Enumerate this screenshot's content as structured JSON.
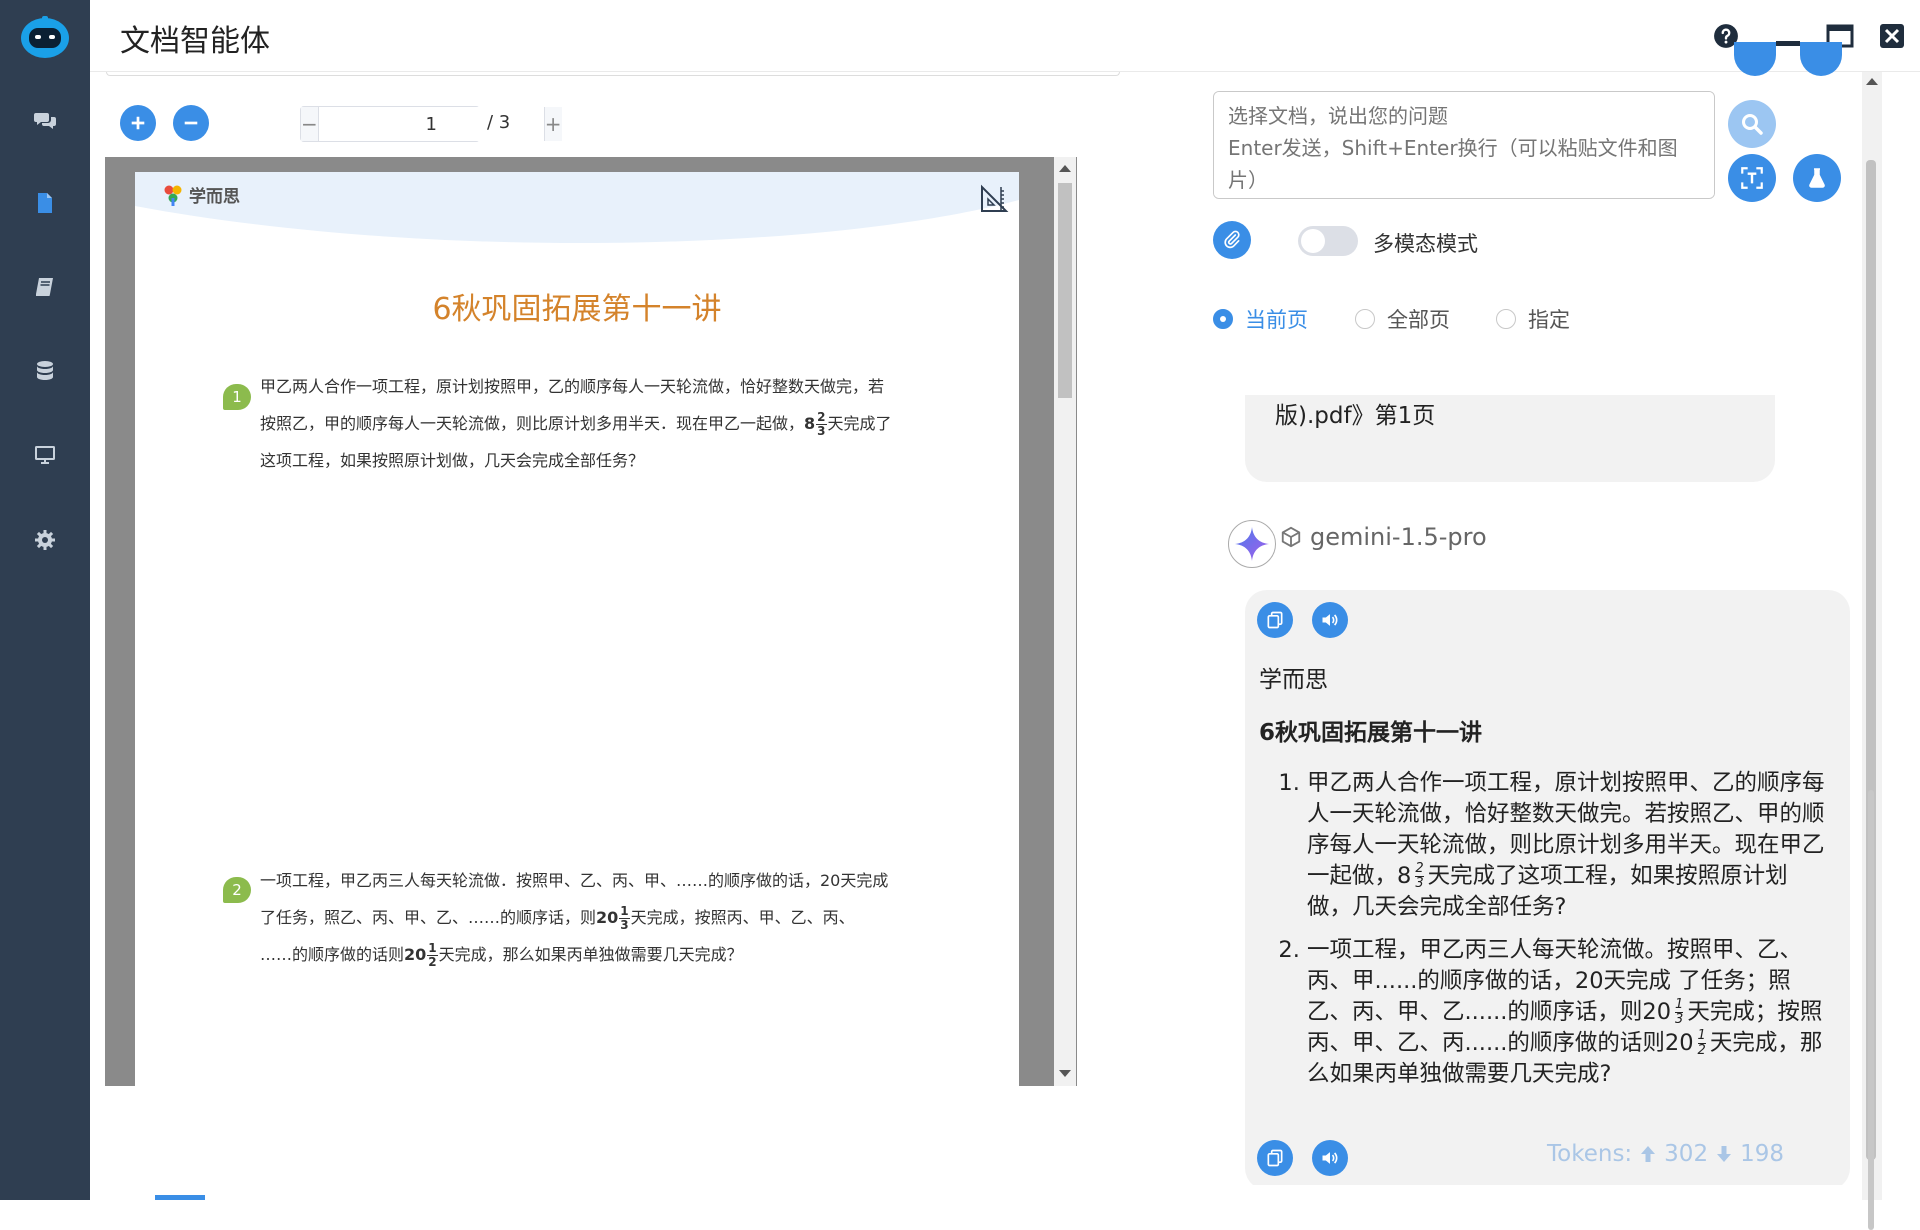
{
  "app": {
    "title": "文档智能体"
  },
  "sidebar": {
    "items": [
      {
        "name": "chat",
        "icon": "comments-icon",
        "active": false
      },
      {
        "name": "document",
        "icon": "file-icon",
        "active": true
      },
      {
        "name": "books",
        "icon": "book-icon",
        "active": false
      },
      {
        "name": "database",
        "icon": "database-icon",
        "active": false
      },
      {
        "name": "desktop",
        "icon": "desktop-icon",
        "active": false
      },
      {
        "name": "settings",
        "icon": "gear-icon",
        "active": false
      }
    ]
  },
  "pdf_toolbar": {
    "current_page": "1",
    "total_pages": "/ 3"
  },
  "pdf_page": {
    "brand": "学而思",
    "title": "6秋巩固拓展第十一讲",
    "q1": {
      "num": "1",
      "line1": "甲乙两人合作一项工程，原计划按照甲，乙的顺序每人一天轮流做，恰好整数天做完，若",
      "line2a": "按照乙，甲的顺序每人一天轮流做，则比原计划多用半天．现在甲乙一起做，",
      "whole": "8",
      "frac_num": "2",
      "frac_den": "3",
      "line2b": "天完成了",
      "line3": "这项工程，如果按照原计划做，几天会完成全部任务？"
    },
    "q2": {
      "num": "2",
      "line1": "一项工程，甲乙丙三人每天轮流做．按照甲、乙、丙、甲、……的顺序做的话，20天完成",
      "line2a": "了任务，照乙、丙、甲、乙、……的顺序话，则",
      "whole1": "20",
      "f1_num": "1",
      "f1_den": "3",
      "line2b": "天完成，按照丙、甲、乙、丙、",
      "line3a": "……的顺序做的话则",
      "whole2": "20",
      "f2_num": "1",
      "f2_den": "2",
      "line3b": "天完成，那么如果丙单独做需要几天完成？"
    }
  },
  "chat": {
    "input_placeholder": "选择文档，说出您的问题\nEnter发送，Shift+Enter换行（可以粘贴文件和图片）",
    "multimodal_label": "多模态模式",
    "radios": [
      {
        "label": "当前页",
        "checked": true
      },
      {
        "label": "全部页",
        "checked": false
      },
      {
        "label": "指定",
        "checked": false
      }
    ],
    "user_message_visible": "版).pdf》第1页",
    "model_name": "gemini-1.5-pro",
    "answer": {
      "brand": "学而思",
      "title": "6秋巩固拓展第十一讲",
      "item1_a": "甲乙两人合作一项工程，原计划按照甲、乙的顺序每人一天轮流做，恰好整数天做完。若按照乙、甲的顺序每人一天轮流做，则比原计划多用半天。现在甲乙一起做，8",
      "item1_frac_num": "2",
      "item1_frac_den": "3",
      "item1_b": "天完成了这项工程，如果按照原计划做，几天会完成全部任务?",
      "item2_a": "一项工程，甲乙丙三人每天轮流做。按照甲、乙、丙、甲......的顺序做的话，20天完成 了任务；照乙、丙、甲、乙......的顺序话，则20",
      "item2_f1_num": "1",
      "item2_f1_den": "3",
      "item2_b": "天完成；按照丙、甲、乙、丙......的顺序做的话则20",
      "item2_f2_num": "1",
      "item2_f2_den": "2",
      "item2_c": "天完成，那么如果丙单独做需要几天完成?"
    },
    "tokens_label": "Tokens:",
    "tokens_up": "302",
    "tokens_down": "198"
  },
  "colors": {
    "sidebar_bg": "#2f3e51",
    "accent": "#3a8ee6",
    "pdf_title": "#d4832b",
    "question_badge": "#8cbb4d"
  }
}
